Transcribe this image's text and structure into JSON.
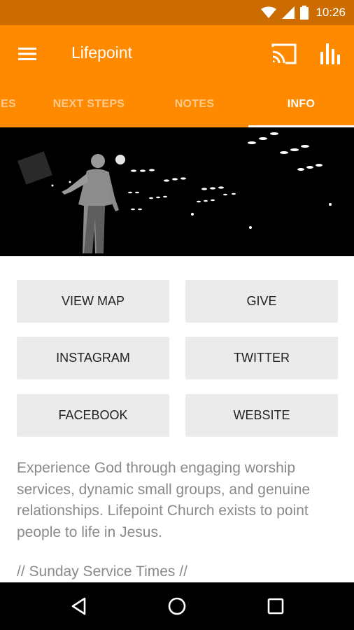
{
  "status_bar": {
    "time": "10:26",
    "icons": [
      "wifi-icon",
      "signal-icon",
      "battery-icon"
    ]
  },
  "app_bar": {
    "title": "Lifepoint",
    "menu_icon": "hamburger-menu-icon",
    "cast_icon": "cast-icon",
    "stats_icon": "bar-chart-icon",
    "background_color": "#ff8a00"
  },
  "tabs": [
    {
      "label": "ES",
      "active": false
    },
    {
      "label": "NEXT STEPS",
      "active": false
    },
    {
      "label": "NOTES",
      "active": false
    },
    {
      "label": "INFO",
      "active": true
    }
  ],
  "buttons": [
    {
      "label": "VIEW MAP"
    },
    {
      "label": "GIVE"
    },
    {
      "label": "INSTAGRAM"
    },
    {
      "label": "TWITTER"
    },
    {
      "label": "FACEBOOK"
    },
    {
      "label": "WEBSITE"
    }
  ],
  "description": "Experience God through engaging worship services, dynamic small groups, and genuine relationships. Lifepoint Church exists to point people to life in Jesus.",
  "service_times": "// Sunday Service Times //",
  "nav_bar": {
    "icons": [
      "back-icon",
      "home-icon",
      "recents-icon"
    ]
  },
  "colors": {
    "accent": "#ff8a00",
    "status_bar": "#cc6c00",
    "button_bg": "#ebebeb",
    "body_text": "#8a8a8a"
  }
}
